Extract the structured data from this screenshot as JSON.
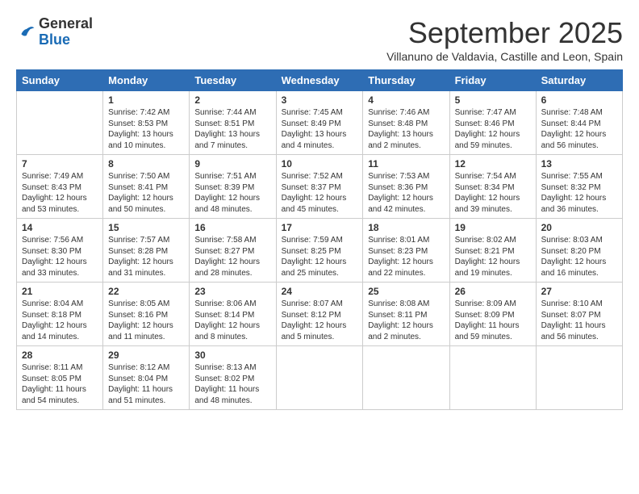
{
  "header": {
    "logo_general": "General",
    "logo_blue": "Blue",
    "month_title": "September 2025",
    "subtitle": "Villanuno de Valdavia, Castille and Leon, Spain"
  },
  "weekdays": [
    "Sunday",
    "Monday",
    "Tuesday",
    "Wednesday",
    "Thursday",
    "Friday",
    "Saturday"
  ],
  "weeks": [
    [
      {
        "day": "",
        "info": ""
      },
      {
        "day": "1",
        "info": "Sunrise: 7:42 AM\nSunset: 8:53 PM\nDaylight: 13 hours\nand 10 minutes."
      },
      {
        "day": "2",
        "info": "Sunrise: 7:44 AM\nSunset: 8:51 PM\nDaylight: 13 hours\nand 7 minutes."
      },
      {
        "day": "3",
        "info": "Sunrise: 7:45 AM\nSunset: 8:49 PM\nDaylight: 13 hours\nand 4 minutes."
      },
      {
        "day": "4",
        "info": "Sunrise: 7:46 AM\nSunset: 8:48 PM\nDaylight: 13 hours\nand 2 minutes."
      },
      {
        "day": "5",
        "info": "Sunrise: 7:47 AM\nSunset: 8:46 PM\nDaylight: 12 hours\nand 59 minutes."
      },
      {
        "day": "6",
        "info": "Sunrise: 7:48 AM\nSunset: 8:44 PM\nDaylight: 12 hours\nand 56 minutes."
      }
    ],
    [
      {
        "day": "7",
        "info": "Sunrise: 7:49 AM\nSunset: 8:43 PM\nDaylight: 12 hours\nand 53 minutes."
      },
      {
        "day": "8",
        "info": "Sunrise: 7:50 AM\nSunset: 8:41 PM\nDaylight: 12 hours\nand 50 minutes."
      },
      {
        "day": "9",
        "info": "Sunrise: 7:51 AM\nSunset: 8:39 PM\nDaylight: 12 hours\nand 48 minutes."
      },
      {
        "day": "10",
        "info": "Sunrise: 7:52 AM\nSunset: 8:37 PM\nDaylight: 12 hours\nand 45 minutes."
      },
      {
        "day": "11",
        "info": "Sunrise: 7:53 AM\nSunset: 8:36 PM\nDaylight: 12 hours\nand 42 minutes."
      },
      {
        "day": "12",
        "info": "Sunrise: 7:54 AM\nSunset: 8:34 PM\nDaylight: 12 hours\nand 39 minutes."
      },
      {
        "day": "13",
        "info": "Sunrise: 7:55 AM\nSunset: 8:32 PM\nDaylight: 12 hours\nand 36 minutes."
      }
    ],
    [
      {
        "day": "14",
        "info": "Sunrise: 7:56 AM\nSunset: 8:30 PM\nDaylight: 12 hours\nand 33 minutes."
      },
      {
        "day": "15",
        "info": "Sunrise: 7:57 AM\nSunset: 8:28 PM\nDaylight: 12 hours\nand 31 minutes."
      },
      {
        "day": "16",
        "info": "Sunrise: 7:58 AM\nSunset: 8:27 PM\nDaylight: 12 hours\nand 28 minutes."
      },
      {
        "day": "17",
        "info": "Sunrise: 7:59 AM\nSunset: 8:25 PM\nDaylight: 12 hours\nand 25 minutes."
      },
      {
        "day": "18",
        "info": "Sunrise: 8:01 AM\nSunset: 8:23 PM\nDaylight: 12 hours\nand 22 minutes."
      },
      {
        "day": "19",
        "info": "Sunrise: 8:02 AM\nSunset: 8:21 PM\nDaylight: 12 hours\nand 19 minutes."
      },
      {
        "day": "20",
        "info": "Sunrise: 8:03 AM\nSunset: 8:20 PM\nDaylight: 12 hours\nand 16 minutes."
      }
    ],
    [
      {
        "day": "21",
        "info": "Sunrise: 8:04 AM\nSunset: 8:18 PM\nDaylight: 12 hours\nand 14 minutes."
      },
      {
        "day": "22",
        "info": "Sunrise: 8:05 AM\nSunset: 8:16 PM\nDaylight: 12 hours\nand 11 minutes."
      },
      {
        "day": "23",
        "info": "Sunrise: 8:06 AM\nSunset: 8:14 PM\nDaylight: 12 hours\nand 8 minutes."
      },
      {
        "day": "24",
        "info": "Sunrise: 8:07 AM\nSunset: 8:12 PM\nDaylight: 12 hours\nand 5 minutes."
      },
      {
        "day": "25",
        "info": "Sunrise: 8:08 AM\nSunset: 8:11 PM\nDaylight: 12 hours\nand 2 minutes."
      },
      {
        "day": "26",
        "info": "Sunrise: 8:09 AM\nSunset: 8:09 PM\nDaylight: 11 hours\nand 59 minutes."
      },
      {
        "day": "27",
        "info": "Sunrise: 8:10 AM\nSunset: 8:07 PM\nDaylight: 11 hours\nand 56 minutes."
      }
    ],
    [
      {
        "day": "28",
        "info": "Sunrise: 8:11 AM\nSunset: 8:05 PM\nDaylight: 11 hours\nand 54 minutes."
      },
      {
        "day": "29",
        "info": "Sunrise: 8:12 AM\nSunset: 8:04 PM\nDaylight: 11 hours\nand 51 minutes."
      },
      {
        "day": "30",
        "info": "Sunrise: 8:13 AM\nSunset: 8:02 PM\nDaylight: 11 hours\nand 48 minutes."
      },
      {
        "day": "",
        "info": ""
      },
      {
        "day": "",
        "info": ""
      },
      {
        "day": "",
        "info": ""
      },
      {
        "day": "",
        "info": ""
      }
    ]
  ]
}
